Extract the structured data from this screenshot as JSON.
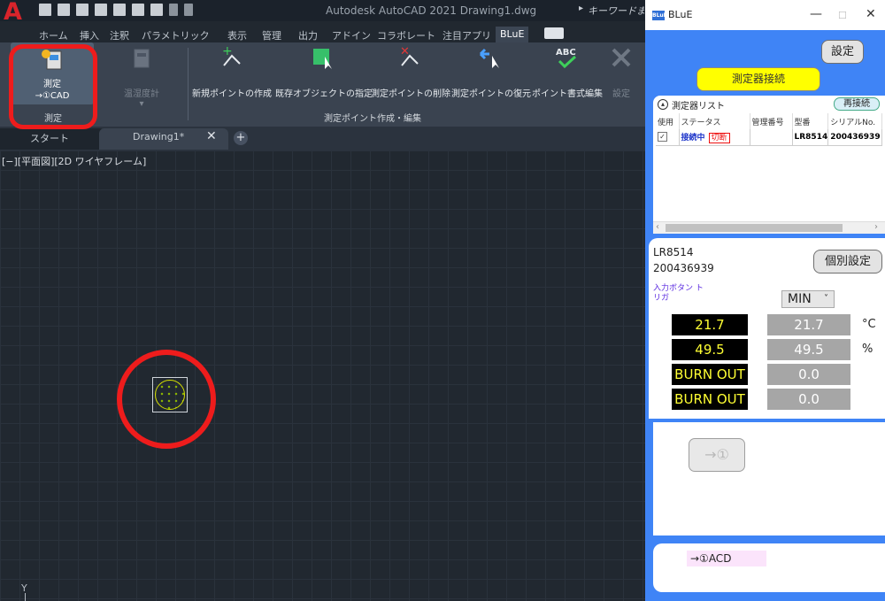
{
  "acad": {
    "title": "Autodesk AutoCAD 2021   Drawing1.dwg",
    "search_placeholder": "キーワードまたは",
    "menu_tabs": [
      "ホーム",
      "挿入",
      "注釈",
      "パラメトリック",
      "表示",
      "管理",
      "出力",
      "アドイン",
      "コラボレート",
      "注目アプリ",
      "BLuE"
    ],
    "ribbon": {
      "measure_label1": "測定",
      "measure_label2": "→①CAD",
      "hygro_label": "温湿度計",
      "new_point": "新規ポイントの作成",
      "existing_object": "既存オブジェクトの指定",
      "delete_point": "測定ポイントの削除",
      "restore_point": "測定ポイントの復元",
      "point_format": "ポイント書式編集",
      "settings": "設定",
      "group_measure": "測定",
      "group_points": "測定ポイント作成・編集"
    },
    "tabs": {
      "start": "スタート",
      "drawing": "Drawing1*",
      "close": "✕",
      "add": "+"
    },
    "view_label": "[−][平面図][2D ワイヤフレーム]",
    "ucs_y": "Y"
  },
  "blue": {
    "title": "BLuE",
    "app_icon": "BLuE",
    "window_buttons": {
      "minimize": "—",
      "maximize": "☐",
      "close": "✕"
    },
    "settings_btn": "設定",
    "connect_btn": "測定器接続",
    "device_list": {
      "title": "測定器リスト",
      "reconnect": "再接続",
      "headers": [
        "使用",
        "ステータス",
        "管理番号",
        "型番",
        "シリアルNo."
      ],
      "rows": [
        {
          "check": "✓",
          "status": "接続中",
          "disconnect": "切断",
          "mgmt_no": "",
          "model": "LR8514",
          "serial": "200436939"
        }
      ]
    },
    "detail": {
      "model": "LR8514",
      "serial": "200436939",
      "indiv_settings": "個別設定",
      "trigger_label": "入力ボタン トリガ",
      "trigger_mode": "MIN",
      "readings": [
        {
          "left": "21.7",
          "right": "21.7",
          "unit": "°C"
        },
        {
          "left": "49.5",
          "right": "49.5",
          "unit": "%"
        },
        {
          "left": "BURN OUT",
          "right": "0.0",
          "unit": ""
        },
        {
          "left": "BURN OUT",
          "right": "0.0",
          "unit": ""
        }
      ]
    },
    "arrow_btn": "→①",
    "bottom_tag": "→①ACD"
  },
  "colors": {
    "highlight_red": "#ee1c1c",
    "connect_yellow": "#ffff00",
    "panel_blue": "#3f84f6"
  }
}
